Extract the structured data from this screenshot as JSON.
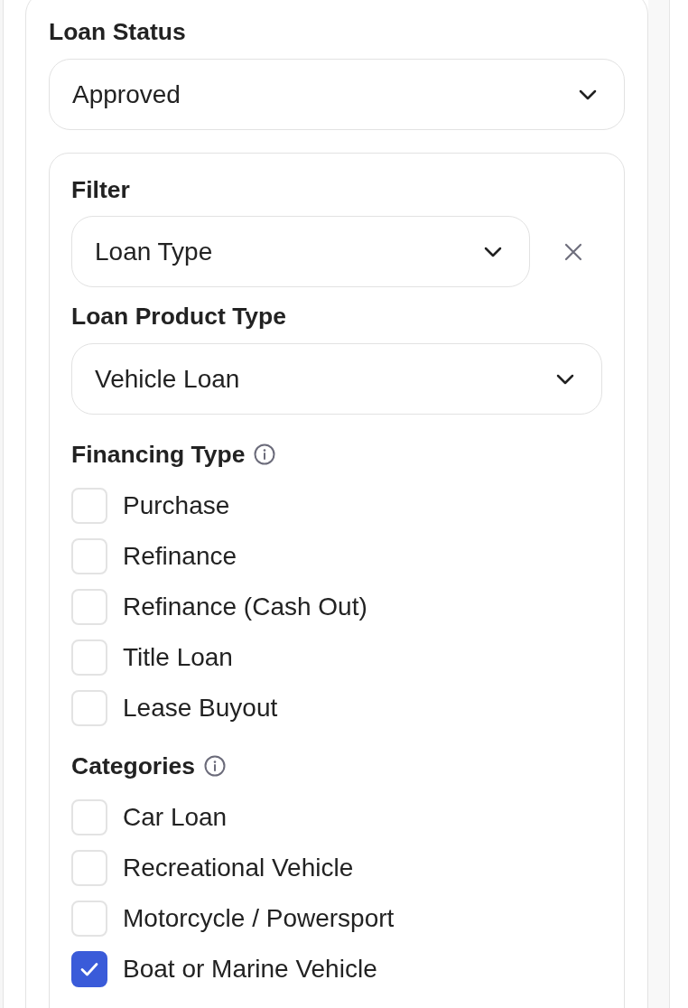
{
  "loan_status": {
    "label": "Loan Status",
    "value": "Approved"
  },
  "filter": {
    "label": "Filter",
    "value": "Loan Type",
    "product_type": {
      "label": "Loan Product Type",
      "value": "Vehicle Loan"
    },
    "groups": [
      {
        "label": "Financing Type",
        "options": [
          {
            "label": "Purchase",
            "checked": false
          },
          {
            "label": "Refinance",
            "checked": false
          },
          {
            "label": "Refinance (Cash Out)",
            "checked": false
          },
          {
            "label": "Title Loan",
            "checked": false
          },
          {
            "label": "Lease Buyout",
            "checked": false
          }
        ]
      },
      {
        "label": "Categories",
        "options": [
          {
            "label": "Car Loan",
            "checked": false
          },
          {
            "label": "Recreational Vehicle",
            "checked": false
          },
          {
            "label": "Motorcycle / Powersport",
            "checked": false
          },
          {
            "label": "Boat or Marine Vehicle",
            "checked": true
          }
        ]
      }
    ]
  }
}
